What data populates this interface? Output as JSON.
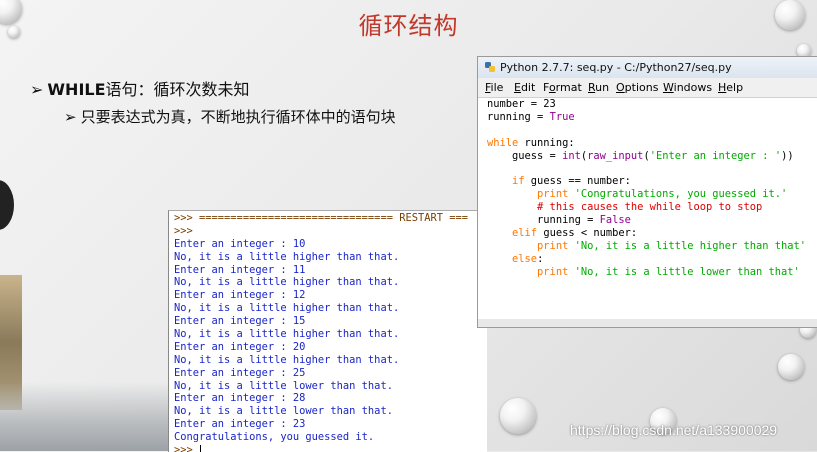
{
  "slide": {
    "title": "循环结构",
    "bullet1_prefix": "WHILE",
    "bullet1_rest": "语句：循环次数未知",
    "bullet2": "只要表达式为真，不断地执行循环体中的语句块"
  },
  "shell": {
    "lines": [
      {
        "text": ">>> =============================== RESTART ===",
        "kind": "prompt"
      },
      {
        "text": ">>>",
        "kind": "prompt"
      },
      {
        "text": "Enter an integer : 10",
        "kind": "output"
      },
      {
        "text": "No, it is a little higher than that.",
        "kind": "output"
      },
      {
        "text": "Enter an integer : 11",
        "kind": "output"
      },
      {
        "text": "No, it is a little higher than that.",
        "kind": "output"
      },
      {
        "text": "Enter an integer : 12",
        "kind": "output"
      },
      {
        "text": "No, it is a little higher than that.",
        "kind": "output"
      },
      {
        "text": "Enter an integer : 15",
        "kind": "output"
      },
      {
        "text": "No, it is a little higher than that.",
        "kind": "output"
      },
      {
        "text": "Enter an integer : 20",
        "kind": "output"
      },
      {
        "text": "No, it is a little higher than that.",
        "kind": "output"
      },
      {
        "text": "Enter an integer : 25",
        "kind": "output"
      },
      {
        "text": "No, it is a little lower than that.",
        "kind": "output"
      },
      {
        "text": "Enter an integer : 28",
        "kind": "output"
      },
      {
        "text": "No, it is a little lower than that.",
        "kind": "output"
      },
      {
        "text": "Enter an integer : 23",
        "kind": "output"
      },
      {
        "text": "Congratulations, you guessed it.",
        "kind": "output"
      },
      {
        "text": ">>> ",
        "kind": "prompt"
      }
    ]
  },
  "editor": {
    "title": "Python 2.7.7: seq.py - C:/Python27/seq.py",
    "menu": [
      {
        "label": "File",
        "key": "F"
      },
      {
        "label": "Edit",
        "key": "E"
      },
      {
        "label": "Format",
        "key": "o"
      },
      {
        "label": "Run",
        "key": "R"
      },
      {
        "label": "Options",
        "key": "O"
      },
      {
        "label": "Windows",
        "key": "W"
      },
      {
        "label": "Help",
        "key": "H"
      }
    ],
    "code": [
      [
        {
          "t": "number = 23",
          "c": "n"
        }
      ],
      [
        {
          "t": "running = ",
          "c": "n"
        },
        {
          "t": "True",
          "c": "b"
        }
      ],
      [],
      [
        {
          "t": "while",
          "c": "k"
        },
        {
          "t": " running:",
          "c": "n"
        }
      ],
      [
        {
          "t": "    guess = ",
          "c": "n"
        },
        {
          "t": "int",
          "c": "b"
        },
        {
          "t": "(",
          "c": "n"
        },
        {
          "t": "raw_input",
          "c": "b"
        },
        {
          "t": "(",
          "c": "n"
        },
        {
          "t": "'Enter an integer : '",
          "c": "s"
        },
        {
          "t": "))",
          "c": "n"
        }
      ],
      [],
      [
        {
          "t": "    ",
          "c": "n"
        },
        {
          "t": "if",
          "c": "k"
        },
        {
          "t": " guess == number:",
          "c": "n"
        }
      ],
      [
        {
          "t": "        ",
          "c": "n"
        },
        {
          "t": "print",
          "c": "k"
        },
        {
          "t": " ",
          "c": "n"
        },
        {
          "t": "'Congratulations, you guessed it.'",
          "c": "s"
        }
      ],
      [
        {
          "t": "        ",
          "c": "n"
        },
        {
          "t": "# this causes the while loop to stop",
          "c": "cm"
        }
      ],
      [
        {
          "t": "        running = ",
          "c": "n"
        },
        {
          "t": "False",
          "c": "b"
        }
      ],
      [
        {
          "t": "    ",
          "c": "n"
        },
        {
          "t": "elif",
          "c": "k"
        },
        {
          "t": " guess < number:",
          "c": "n"
        }
      ],
      [
        {
          "t": "        ",
          "c": "n"
        },
        {
          "t": "print",
          "c": "k"
        },
        {
          "t": " ",
          "c": "n"
        },
        {
          "t": "'No, it is a little higher than that'",
          "c": "s"
        }
      ],
      [
        {
          "t": "    ",
          "c": "n"
        },
        {
          "t": "else",
          "c": "k"
        },
        {
          "t": ":",
          "c": "n"
        }
      ],
      [
        {
          "t": "        ",
          "c": "n"
        },
        {
          "t": "print",
          "c": "k"
        },
        {
          "t": " ",
          "c": "n"
        },
        {
          "t": "'No, it is a little lower than that'",
          "c": "s"
        }
      ]
    ]
  },
  "watermark": "https://blog.csdn.net/a133900029",
  "colors": {
    "title": "#c0392b",
    "shell_prompt": "#7a3d00",
    "shell_output": "#1a25c8",
    "keyword": "#ff7700",
    "builtin": "#900090",
    "string": "#00aa00",
    "comment": "#dd0000"
  }
}
